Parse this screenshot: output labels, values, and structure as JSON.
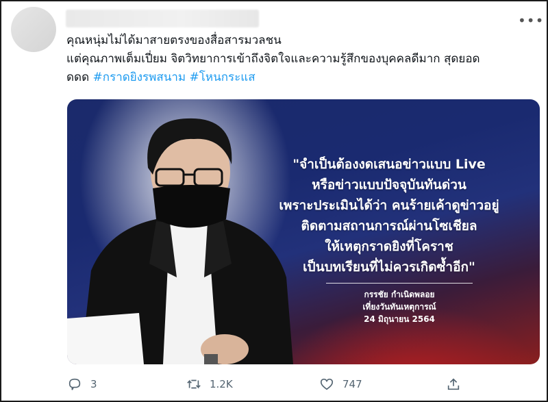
{
  "tweet": {
    "text_lines": [
      "คุณหนุ่มไม่ได้มาสายตรงของสื่อสารมวลชน",
      "แต่คุณภาพเต็มเปี่ยม จิตวิทยาการเข้าถึงจิตใจและความรู้สึกของบุคคลดีมาก สุดยอด",
      "ดดด"
    ],
    "hashtags": [
      "#กราดยิงรพสนาม",
      "#โหนกระแส"
    ]
  },
  "media": {
    "quote_lines": [
      "\"จำเป็นต้องงดเสนอข่าวแบบ Live",
      "หรือข่าวแบบปัจจุบันทันด่วน",
      "เพราะประเมินได้ว่า คนร้ายเค้าดูข่าวอยู่",
      "ติดตามสถานการณ์ผ่านโซเชียล",
      "ให้เหตุกราดยิงที่โคราช",
      "เป็นบทเรียนที่ไม่ควรเกิดซ้ำอีก\""
    ],
    "credit_name": "กรรชัย กำเนิดพลอย",
    "credit_show": "เที่ยงวันทันเหตุการณ์",
    "credit_date": "24 มิถุนายน 2564"
  },
  "actions": {
    "reply_count": "3",
    "retweet_count": "1.2K",
    "like_count": "747"
  },
  "icons": {
    "more": "more-icon",
    "reply": "reply-icon",
    "retweet": "retweet-icon",
    "like": "like-icon",
    "share": "share-icon"
  },
  "colors": {
    "hashtag": "#1d9bf0",
    "action_gray": "#536471"
  }
}
